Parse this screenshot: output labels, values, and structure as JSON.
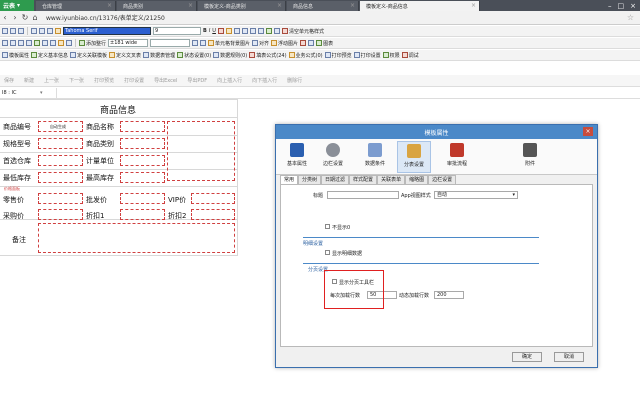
{
  "browser": {
    "app_label": "云表",
    "tabs": [
      {
        "label": "仓库管理"
      },
      {
        "label": "商品类别"
      },
      {
        "label": "模板定义-商品类别"
      },
      {
        "label": "商品信息"
      },
      {
        "label": "模板定义-商品信息"
      }
    ],
    "url": "www.iyunbiao.cn/13176/表单定义/21250"
  },
  "toolbar": {
    "font_name": "Tahoma Serif",
    "font_size": "9",
    "clear_format": "清空单元格样式",
    "row2": [
      "添加整行",
      "±181 wide",
      "单元格背景图片",
      "对齐",
      "浮动图片",
      "图表"
    ],
    "row3": [
      "模板属性",
      "定义基本信息",
      "定义关联模板",
      "定义文叉表",
      "数据表管理",
      "状态设置(0)",
      "数据规则(0)",
      "填表公式(24)",
      "业务公式(0)",
      "打印预览",
      "打印设置",
      "权限",
      "调试"
    ]
  },
  "actions": [
    "保存",
    "新建",
    "上一张",
    "下一张",
    "打印预览",
    "打印设置",
    "导出Excel",
    "导出PDF",
    "向上插入行",
    "向下插入行",
    "删除行"
  ],
  "formula_bar": {
    "cell_ref": "I8 : IC"
  },
  "sheet": {
    "title": "商品信息",
    "labels": [
      "商品编号",
      "商品名称",
      "规格型号",
      "商品类别",
      "首选仓库",
      "计量单位",
      "最低库存",
      "最高库存",
      "零售价",
      "批发价",
      "VIP价",
      "采购价",
      "折扣1",
      "折扣2",
      "备注"
    ],
    "auto_gen": "自动生成",
    "price_hint": "价格面板"
  },
  "dialog": {
    "title": "模板属性",
    "ribbon": [
      "基本属性",
      "边栏设置",
      "数据条件",
      "分表设置",
      "审批流程",
      "附件"
    ],
    "subtabs": [
      "常用",
      "分类树",
      "日期过滤",
      "样式配置",
      "关联表单",
      "缩略图",
      "边栏设置"
    ],
    "title_label": "标题",
    "app_view_label": "App视图样式",
    "app_view_value": "自动",
    "hide_label": "不显示0",
    "detail_section": "明细设置",
    "show_detail": "显示明细数据",
    "paging_section": "分页设置",
    "show_paging": "显示分页工具栏",
    "per_page_label": "每次加载行数",
    "per_page_value": "50",
    "dyn_label": "动态加载行数",
    "dyn_value": "200",
    "ok": "确定",
    "cancel": "取消"
  }
}
